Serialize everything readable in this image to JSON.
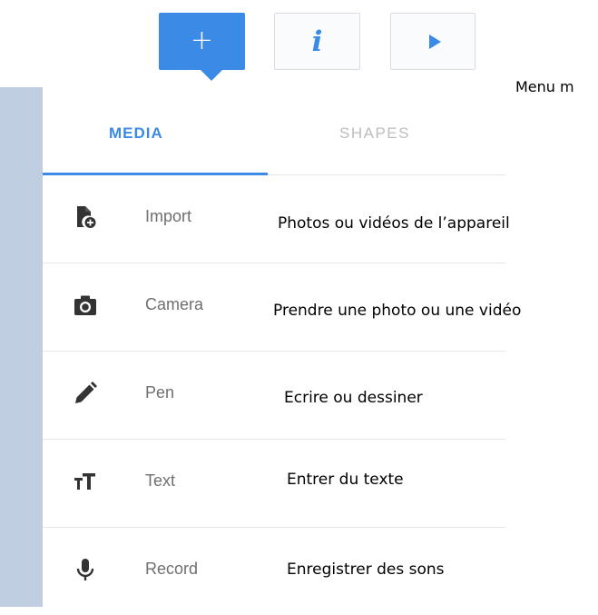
{
  "toolbar": {
    "add_label": "+",
    "info_label": "i",
    "play_icon": "play-icon",
    "accent_color": "#3b8ae6"
  },
  "side_note": "Menu m",
  "tabs": [
    {
      "label": "MEDIA",
      "active": true
    },
    {
      "label": "SHAPES",
      "active": false
    }
  ],
  "menu": [
    {
      "label": "Import",
      "icon": "file-add-icon",
      "description": "Photos ou vidéos de l’appareil"
    },
    {
      "label": "Camera",
      "icon": "camera-icon",
      "description": "Prendre une photo ou une vidéo"
    },
    {
      "label": "Pen",
      "icon": "pen-icon",
      "description": "Ecrire ou dessiner"
    },
    {
      "label": "Text",
      "icon": "text-size-icon",
      "description": "Entrer du texte"
    },
    {
      "label": "Record",
      "icon": "microphone-icon",
      "description": "Enregistrer des sons"
    }
  ]
}
